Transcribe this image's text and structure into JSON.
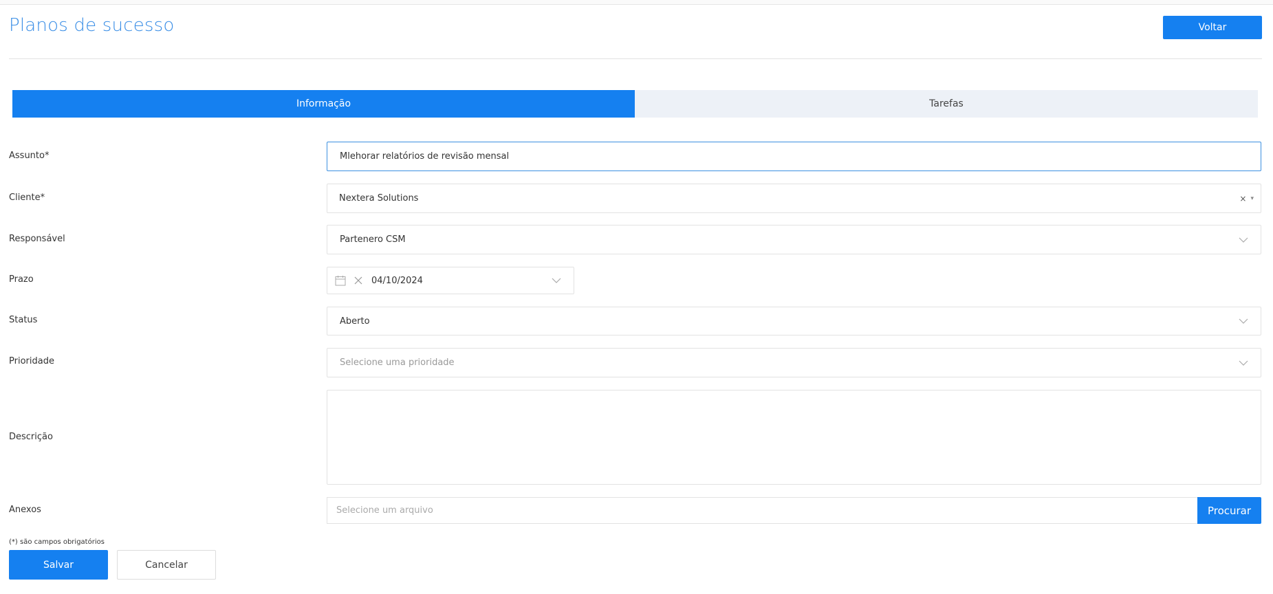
{
  "header": {
    "title": "Planos de sucesso",
    "back_label": "Voltar"
  },
  "tabs": [
    {
      "label": "Informação",
      "active": true
    },
    {
      "label": "Tarefas",
      "active": false
    }
  ],
  "form": {
    "assunto": {
      "label": "Assunto*",
      "value": "Mlehorar relatórios de revisão mensal"
    },
    "cliente": {
      "label": "Cliente*",
      "value": "Nextera Solutions",
      "clear": "×",
      "arrow": "▾"
    },
    "responsavel": {
      "label": "Responsável",
      "value": "Partenero CSM"
    },
    "prazo": {
      "label": "Prazo",
      "value": "04/10/2024"
    },
    "status": {
      "label": "Status",
      "value": "Aberto"
    },
    "prioridade": {
      "label": "Prioridade",
      "placeholder": "Selecione uma prioridade"
    },
    "descricao": {
      "label": "Descrição",
      "value": ""
    },
    "anexos": {
      "label": "Anexos",
      "placeholder": "Selecione um arquivo",
      "browse_label": "Procurar"
    }
  },
  "footer": {
    "required_note": "(*) são campos obrigatórios",
    "save_label": "Salvar",
    "cancel_label": "Cancelar"
  },
  "colors": {
    "accent": "#1580f0",
    "title": "#3a8ee6",
    "tab_inactive_bg": "#edf1f7",
    "border": "#e2e2e2"
  },
  "icons": [
    "calendar-icon",
    "clear-icon",
    "chevron-down-icon"
  ]
}
